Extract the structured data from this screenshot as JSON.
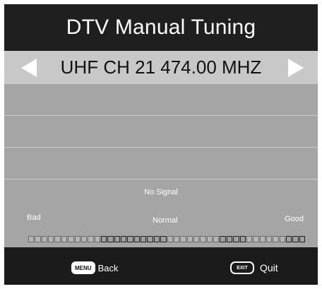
{
  "header": {
    "title": "DTV  Manual Tuning"
  },
  "channel": {
    "label": "UHF CH 21 474.00 MHZ"
  },
  "signal": {
    "status": "No Signal",
    "scale": {
      "bad": "Bad",
      "normal": "Normal",
      "good": "Good"
    },
    "meter_pattern": [
      0,
      0,
      0,
      0,
      0,
      0,
      0,
      0,
      0,
      0,
      0,
      1,
      1,
      1,
      1,
      1,
      1,
      1,
      1,
      1,
      1,
      0,
      0,
      0,
      0,
      0,
      0,
      0,
      0,
      1,
      1,
      1,
      1,
      0,
      0,
      0,
      0,
      0,
      0,
      1,
      1,
      1
    ]
  },
  "footer": {
    "back_key": "MENU",
    "back_label": "Back",
    "quit_key": "EXIT",
    "quit_label": "Quit"
  },
  "colors": {
    "frame": "#1f1f1f",
    "channel_bar": "#c8c8c8",
    "panel": "#a5a5a5",
    "footer": "#1b1b1b"
  },
  "icons": {
    "left": "left-arrow-icon",
    "right": "right-arrow-icon"
  }
}
